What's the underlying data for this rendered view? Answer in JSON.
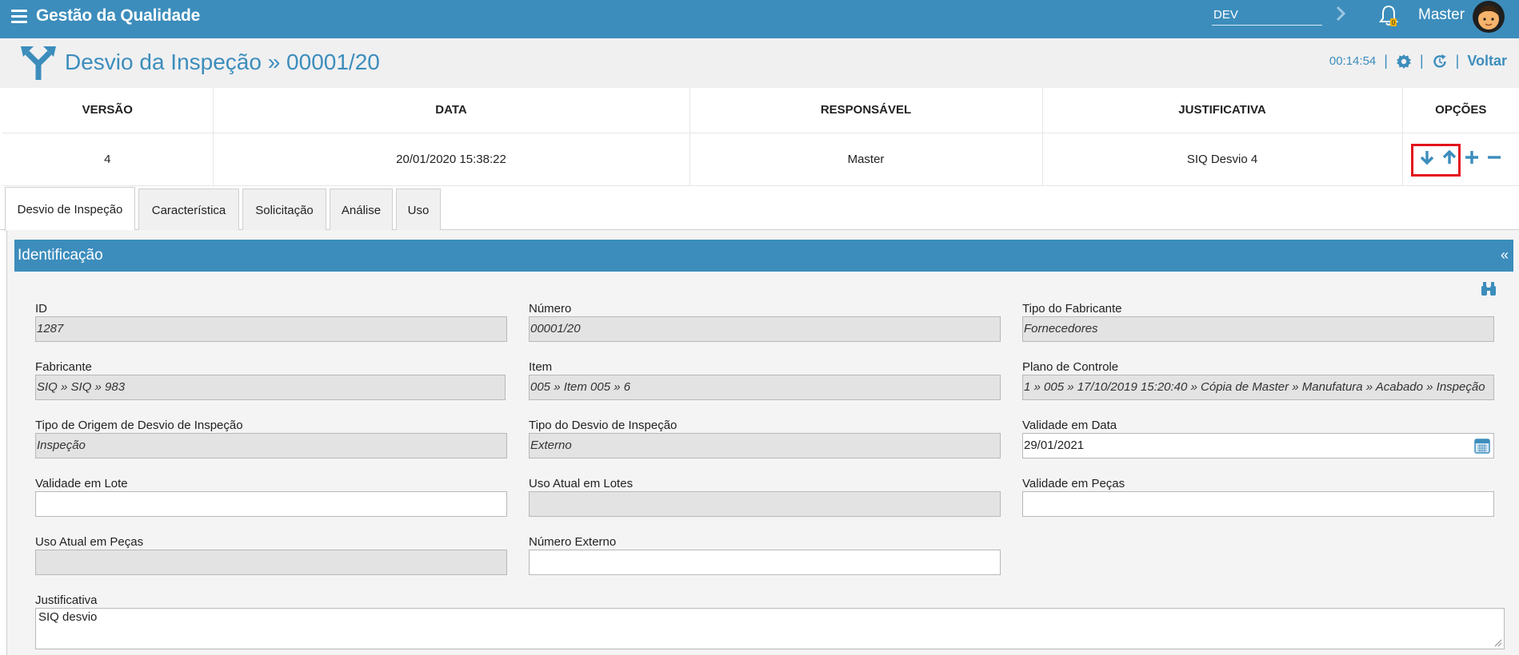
{
  "topbar": {
    "app_title": "Gestão da Qualidade",
    "environment": "DEV",
    "user_name": "Master",
    "brand_color": "#3c8dbc"
  },
  "header": {
    "title": "Desvio da Inspeção » 00001/20",
    "timer": "00:14:54",
    "back_label": "Voltar"
  },
  "versions": {
    "columns": [
      "VERSÃO",
      "DATA",
      "RESPONSÁVEL",
      "JUSTIFICATIVA",
      "OPÇÕES"
    ],
    "rows": [
      {
        "versao": "4",
        "data": "20/01/2020 15:38:22",
        "responsavel": "Master",
        "justificativa": "SIQ Desvio 4"
      }
    ],
    "option_icons": [
      "arrow-down-icon",
      "arrow-up-icon",
      "plus-icon",
      "minus-icon"
    ]
  },
  "tabs": [
    "Desvio de Inspeção",
    "Característica",
    "Solicitação",
    "Análise",
    "Uso"
  ],
  "section": {
    "title": "Identificação",
    "collapse": "«"
  },
  "fields": {
    "id": {
      "label": "ID",
      "value": "1287"
    },
    "numero": {
      "label": "Número",
      "value": "00001/20"
    },
    "tipo_fabricante": {
      "label": "Tipo do Fabricante",
      "value": "Fornecedores"
    },
    "fabricante": {
      "label": "Fabricante",
      "value": "SIQ » SIQ » 983"
    },
    "item": {
      "label": "Item",
      "value": "005 » Item 005 » 6"
    },
    "plano_controle": {
      "label": "Plano de Controle",
      "value": "1 » 005 » 17/10/2019 15:20:40 » Cópia de Master » Manufatura » Acabado » Inspeção"
    },
    "tipo_origem": {
      "label": "Tipo de Origem de Desvio de Inspeção",
      "value": "Inspeção"
    },
    "tipo_desvio": {
      "label": "Tipo do Desvio de Inspeção",
      "value": "Externo"
    },
    "validade_data": {
      "label": "Validade em Data",
      "value": "29/01/2021"
    },
    "validade_lote": {
      "label": "Validade em Lote",
      "value": ""
    },
    "uso_lotes": {
      "label": "Uso Atual em Lotes",
      "value": ""
    },
    "validade_pecas": {
      "label": "Validade em Peças",
      "value": ""
    },
    "uso_pecas": {
      "label": "Uso Atual em Peças",
      "value": ""
    },
    "numero_externo": {
      "label": "Número Externo",
      "value": ""
    },
    "justificativa": {
      "label": "Justificativa",
      "value": "SIQ desvio"
    }
  }
}
